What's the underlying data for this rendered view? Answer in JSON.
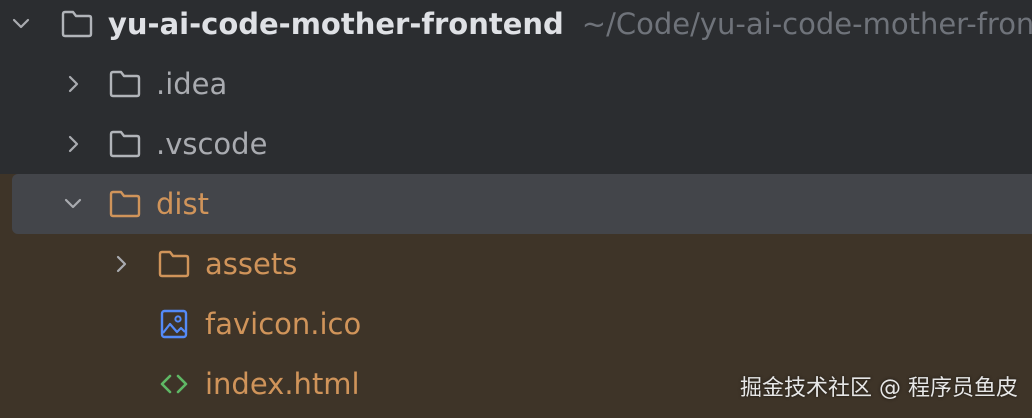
{
  "project_tree": {
    "root": {
      "name": "yu-ai-code-mother-frontend",
      "path": "~/Code/yu-ai-code-mother-frontend"
    },
    "items": [
      {
        "label": ".idea",
        "type": "folder",
        "state": "collapsed"
      },
      {
        "label": ".vscode",
        "type": "folder",
        "state": "collapsed"
      },
      {
        "label": "dist",
        "type": "folder",
        "state": "expanded",
        "selected": true,
        "excluded": true
      },
      {
        "label": "assets",
        "type": "folder",
        "state": "collapsed",
        "excluded": true
      },
      {
        "label": "favicon.ico",
        "type": "image-file",
        "excluded": true
      },
      {
        "label": "index.html",
        "type": "html-file",
        "excluded": true
      }
    ]
  },
  "colors": {
    "background": "#2b2d30",
    "excluded_row_background": "#3e3428",
    "selected_row_background": "#43454a",
    "excluded_text": "#d0945a",
    "folder_icon_gray": "#b1b4b9",
    "image_icon_blue": "#548af7",
    "html_icon_green": "#5fb865",
    "path_text": "#6f737a"
  },
  "icons": {
    "expanded": "chevron-down-icon",
    "collapsed": "chevron-right-icon",
    "folder": "folder-icon",
    "image_file": "image-file-icon",
    "html_file": "html-file-icon"
  },
  "watermark": "掘金技术社区 @ 程序员鱼皮"
}
